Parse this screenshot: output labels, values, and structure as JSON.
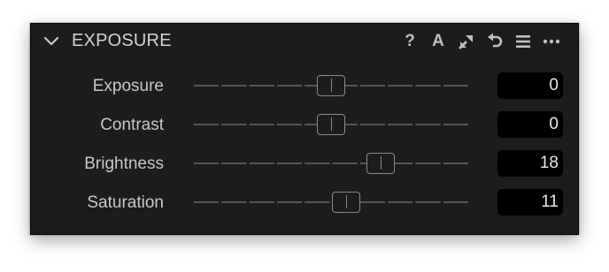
{
  "panel": {
    "title": "EXPOSURE",
    "tools": [
      {
        "name": "help-icon",
        "glyph": "?"
      },
      {
        "name": "auto-icon",
        "glyph": "A"
      },
      {
        "name": "copy-apply-icon",
        "glyph": ""
      },
      {
        "name": "reset-icon",
        "glyph": ""
      },
      {
        "name": "presets-menu-icon",
        "glyph": ""
      },
      {
        "name": "more-icon",
        "glyph": ""
      }
    ]
  },
  "sliders": [
    {
      "id": "exposure",
      "label": "Exposure",
      "value": "0",
      "fraction": 0.5
    },
    {
      "id": "contrast",
      "label": "Contrast",
      "value": "0",
      "fraction": 0.5
    },
    {
      "id": "brightness",
      "label": "Brightness",
      "value": "18",
      "fraction": 0.68
    },
    {
      "id": "saturation",
      "label": "Saturation",
      "value": "11",
      "fraction": 0.555
    }
  ],
  "colors": {
    "panel_background": "#1c1c1c",
    "field_background": "#000000",
    "text": "#c8c8c8",
    "track": "#6a6a6a"
  }
}
